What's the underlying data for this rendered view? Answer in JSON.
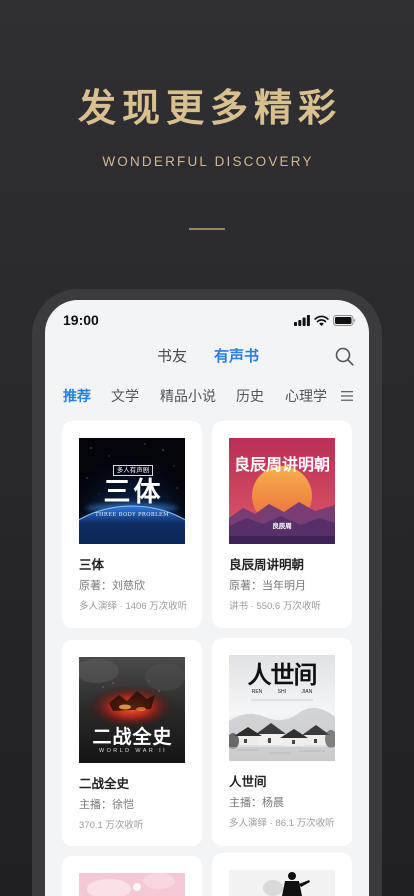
{
  "hero": {
    "title": "发现更多精彩",
    "subtitle": "WONDERFUL DISCOVERY"
  },
  "status_bar": {
    "time": "19:00",
    "icons": [
      "cellular-signal-icon",
      "wifi-icon",
      "battery-icon"
    ]
  },
  "top_nav": {
    "tabs": [
      {
        "label": "书友",
        "active": false
      },
      {
        "label": "有声书",
        "active": true
      }
    ],
    "search_icon": "search-icon"
  },
  "categories": {
    "tabs": [
      {
        "label": "推荐",
        "active": true
      },
      {
        "label": "文学",
        "active": false
      },
      {
        "label": "精品小说",
        "active": false
      },
      {
        "label": "历史",
        "active": false
      },
      {
        "label": "心理学",
        "active": false
      }
    ],
    "menu_icon": "menu-icon"
  },
  "books": [
    {
      "title": "三体",
      "credit": "原著：刘慈欣",
      "meta": "多人演绎 · 1406 万次收听",
      "cover": {
        "badge": "多人有声剧",
        "title": "三体",
        "subtitle": "THREE BODY PROBLEM"
      }
    },
    {
      "title": "良辰周讲明朝",
      "credit": "原著：当年明月",
      "meta": "讲书 · 550.6 万次收听",
      "cover": {
        "title": "良辰周讲明朝",
        "signature": "良辰周"
      }
    },
    {
      "title": "二战全史",
      "credit": "主播：徐恺",
      "meta": "370.1 万次收听",
      "cover": {
        "title": "二战全史",
        "subtitle": "WORLD WAR II"
      }
    },
    {
      "title": "人世间",
      "credit": "主播：杨晨",
      "meta": "多人演绎 · 86.1 万次收听",
      "cover": {
        "title": "人世间",
        "subtitle": "REN SHI JIAN"
      }
    }
  ],
  "colors": {
    "accent": "#2b7de9",
    "gold": "#d8c08f",
    "screen": "#f3f4f6"
  }
}
